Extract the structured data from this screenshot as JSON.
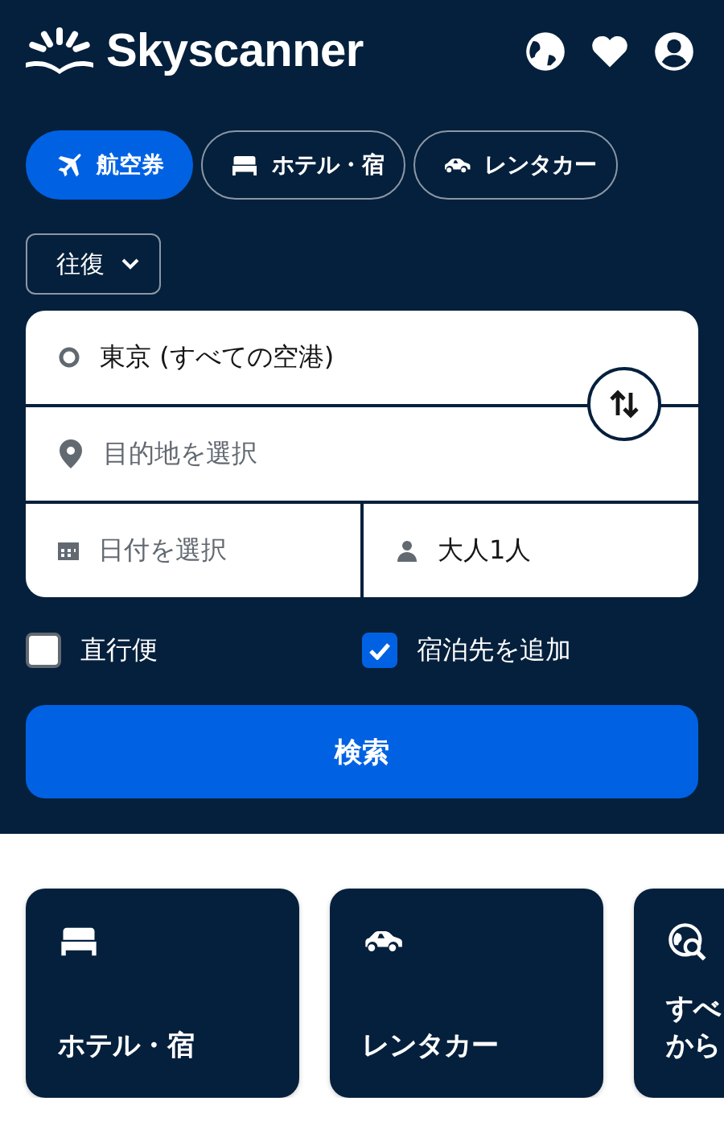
{
  "header": {
    "logo": "Skyscanner"
  },
  "tabs": [
    {
      "label": "航空券",
      "kind": "flight",
      "selected": true
    },
    {
      "label": "ホテル・宿",
      "kind": "hotel",
      "selected": false
    },
    {
      "label": "レンタカー",
      "kind": "car",
      "selected": false
    }
  ],
  "trip_type": {
    "value": "往復"
  },
  "form": {
    "origin": {
      "value": "東京 (すべての空港)"
    },
    "destination": {
      "placeholder": "目的地を選択"
    },
    "dates": {
      "placeholder": "日付を選択"
    },
    "travellers": {
      "value": "大人1人"
    }
  },
  "options": [
    {
      "label": "直行便",
      "checked": false
    },
    {
      "label": "宿泊先を追加",
      "checked": true
    }
  ],
  "search_button": "検索",
  "cards": [
    {
      "kind": "hotel",
      "lines": [
        "ホテル・宿"
      ]
    },
    {
      "kind": "car",
      "lines": [
        "レンタカー"
      ]
    },
    {
      "kind": "explore",
      "lines": [
        "すべ",
        "から"
      ]
    }
  ]
}
